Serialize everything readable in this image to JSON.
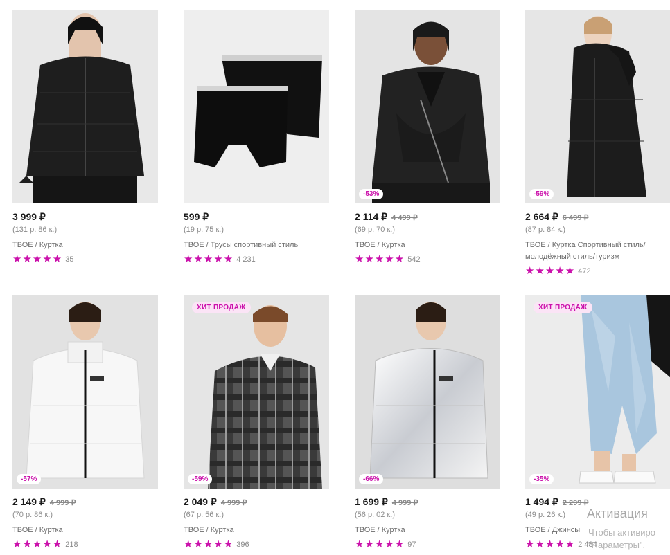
{
  "products": [
    {
      "price": "3 999 ₽",
      "old_price": "",
      "installment": "(131 р. 86 к.)",
      "brand_line": "ТВОЕ / Куртка",
      "rating_count": "35",
      "discount": "",
      "hit": "",
      "stars": "★★★★★",
      "image": "puffer-jacket-black-image"
    },
    {
      "price": "599 ₽",
      "old_price": "",
      "installment": "(19 р. 75 к.)",
      "brand_line": "ТВОЕ / Трусы спортивный стиль",
      "rating_count": "4 231",
      "discount": "",
      "hit": "",
      "stars": "★★★★★",
      "image": "boxer-briefs-black-image"
    },
    {
      "price": "2 114 ₽",
      "old_price": "4 499 ₽",
      "installment": "(69 р. 70 к.)",
      "brand_line": "ТВОЕ / Куртка",
      "rating_count": "542",
      "discount": "-53%",
      "hit": "",
      "stars": "★★★★★",
      "image": "leather-biker-jacket-image"
    },
    {
      "price": "2 664 ₽",
      "old_price": "6 499 ₽",
      "installment": "(87 р. 84 к.)",
      "brand_line": "ТВОЕ / Куртка Спортивный стиль/ молодёжный стиль/туризм",
      "rating_count": "472",
      "discount": "-59%",
      "hit": "",
      "stars": "★★★★★",
      "image": "long-parka-black-image"
    },
    {
      "price": "2 149 ₽",
      "old_price": "4 999 ₽",
      "installment": "(70 р. 86 к.)",
      "brand_line": "ТВОЕ / Куртка",
      "rating_count": "218",
      "discount": "-57%",
      "hit": "",
      "stars": "★★★★★",
      "image": "puffer-jacket-white-image"
    },
    {
      "price": "2 049 ₽",
      "old_price": "4 999 ₽",
      "installment": "(67 р. 56 к.)",
      "brand_line": "ТВОЕ / Куртка",
      "rating_count": "396",
      "discount": "-59%",
      "hit": "ХИТ ПРОДАЖ",
      "stars": "★★★★★",
      "image": "plaid-shirt-jacket-image"
    },
    {
      "price": "1 699 ₽",
      "old_price": "4 999 ₽",
      "installment": "(56 р. 02 к.)",
      "brand_line": "ТВОЕ / Куртка",
      "rating_count": "97",
      "discount": "-66%",
      "hit": "",
      "stars": "★★★★★",
      "image": "reflective-puffer-jacket-image"
    },
    {
      "price": "1 494 ₽",
      "old_price": "2 299 ₽",
      "installment": "(49 р. 26 к.)",
      "brand_line": "ТВОЕ / Джинсы",
      "rating_count": "2 484",
      "discount": "-35%",
      "hit": "ХИТ ПРОДАЖ",
      "stars": "★★★★★",
      "image": "light-wash-jeans-image"
    }
  ],
  "watermark": {
    "line1": "Активация",
    "line2": "Чтобы активиро",
    "line3": "\"Параметры\"."
  },
  "colors": {
    "accent": "#cb11ab",
    "photo_bg": "#e6e6e6"
  }
}
